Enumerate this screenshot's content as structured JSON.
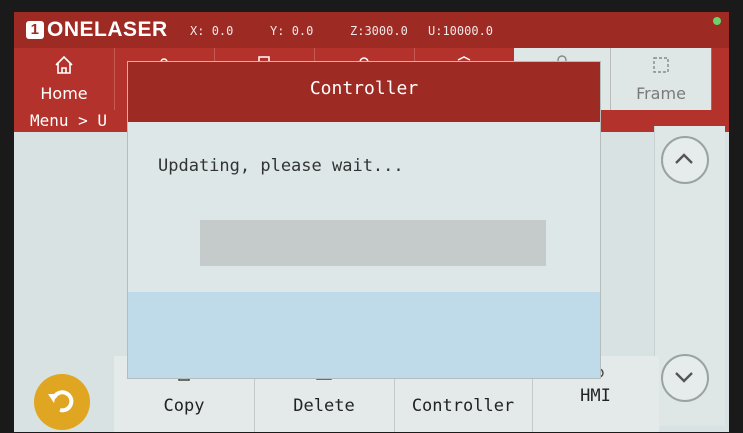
{
  "brand": {
    "logo_badge": "1",
    "logo_text": "ONELASER"
  },
  "coords": {
    "x_label": "X:",
    "x_value": "0.0",
    "y_label": "Y:",
    "y_value": "0.0",
    "z_label": "Z:",
    "z_value": "3000.0",
    "u_label": "U:",
    "u_value": "10000.0"
  },
  "menu": {
    "home_label": "Home",
    "frame_label": "Frame",
    "breadcrumb": "Menu > U"
  },
  "modal": {
    "title": "Controller",
    "message": "Updating, please wait...",
    "progress": 0
  },
  "bottom": {
    "copy_label": "Copy",
    "delete_label": "Delete",
    "controller_label": "Controller",
    "hmi_label": "HMI"
  },
  "colors": {
    "header_red": "#9e2a24",
    "menu_red": "#b3332c",
    "undo_yellow": "#e0a521",
    "status_green": "#6ad36a"
  }
}
